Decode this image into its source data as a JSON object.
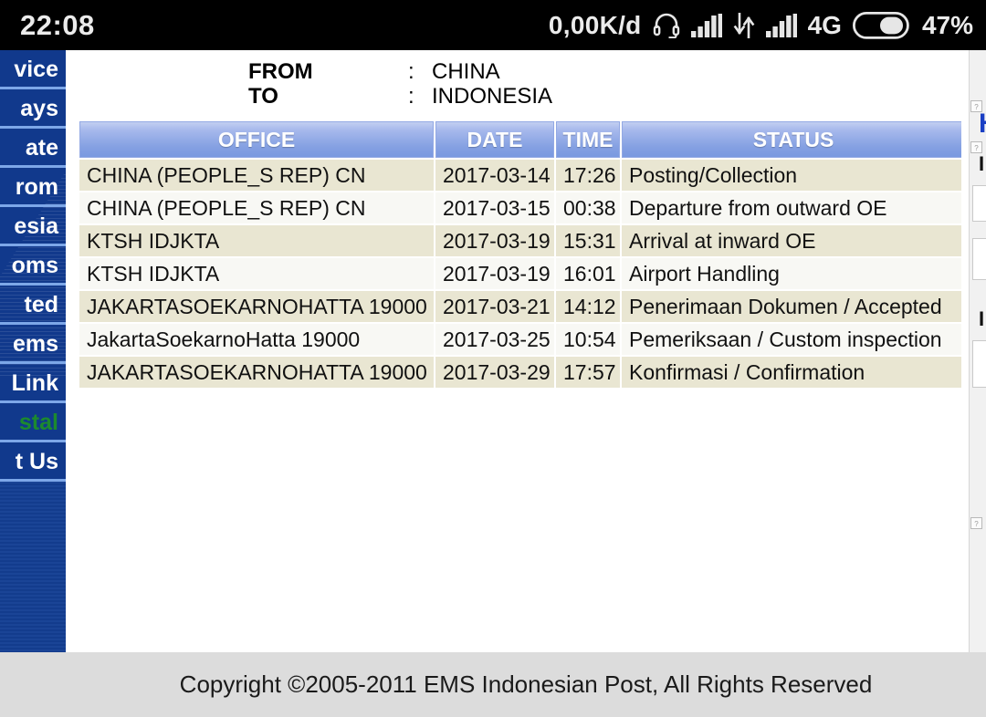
{
  "statusbar": {
    "clock": "22:08",
    "net_speed": "0,00K/d",
    "headset_icon": "headset-icon",
    "signal1_icon": "signal-bars-icon",
    "data_transfer_icon": "data-transfer-arrows-icon",
    "signal2_icon": "signal-bars-icon",
    "network_type": "4G",
    "battery_icon": "battery-icon",
    "battery_percent": "47%"
  },
  "sidebar": {
    "background_color": "#11398c",
    "items": [
      {
        "label": "vice",
        "full_hint": "vice",
        "green": false
      },
      {
        "label": "ays",
        "full_hint": "ays",
        "green": false
      },
      {
        "label": "ate",
        "full_hint": "ate",
        "green": false
      },
      {
        "label": "rom",
        "full_hint": "rom",
        "green": false
      },
      {
        "label": "esia",
        "full_hint": "esia",
        "green": false
      },
      {
        "label": "oms",
        "full_hint": "oms",
        "green": false
      },
      {
        "label": "ted",
        "full_hint": "ted",
        "green": false
      },
      {
        "label": "ems",
        "full_hint": "ems",
        "green": false
      },
      {
        "label": "Link",
        "full_hint": "Link",
        "green": false
      },
      {
        "label": "stal",
        "full_hint": "stal",
        "green": true
      },
      {
        "label": "t Us",
        "full_hint": "t Us",
        "green": false
      }
    ]
  },
  "route": {
    "from_label": "FROM",
    "from_colon": ":",
    "from_value": "CHINA",
    "to_label": "TO",
    "to_colon": ":",
    "to_value": "INDONESIA"
  },
  "table": {
    "header_accent": "#84a0e2",
    "columns": [
      "OFFICE",
      "DATE",
      "TIME",
      "STATUS"
    ],
    "rows": [
      [
        "CHINA (PEOPLE_S REP) CN",
        "2017-03-14",
        "17:26",
        "Posting/Collection"
      ],
      [
        "CHINA (PEOPLE_S REP) CN",
        "2017-03-15",
        "00:38",
        "Departure from outward OE"
      ],
      [
        "KTSH IDJKTA",
        "2017-03-19",
        "15:31",
        "Arrival at inward OE"
      ],
      [
        "KTSH IDJKTA",
        "2017-03-19",
        "16:01",
        "Airport Handling"
      ],
      [
        "JAKARTASOEKARNOHATTA 19000",
        "2017-03-21",
        "14:12",
        "Penerimaan Dokumen / Accepted"
      ],
      [
        "JakartaSoekarnoHatta 19000",
        "2017-03-25",
        "10:54",
        "Pemeriksaan / Custom inspection"
      ],
      [
        "JAKARTASOEKARNOHATTA 19000",
        "2017-03-29",
        "17:57",
        "Konfirmasi / Confirmation"
      ]
    ]
  },
  "right_sliver": {
    "partial_heading": "H",
    "partial_glyph": "I"
  },
  "footer": {
    "copyright": "Copyright ©2005-2011 EMS Indonesian Post, All Rights Reserved",
    "background_color": "#dcdcdc"
  }
}
